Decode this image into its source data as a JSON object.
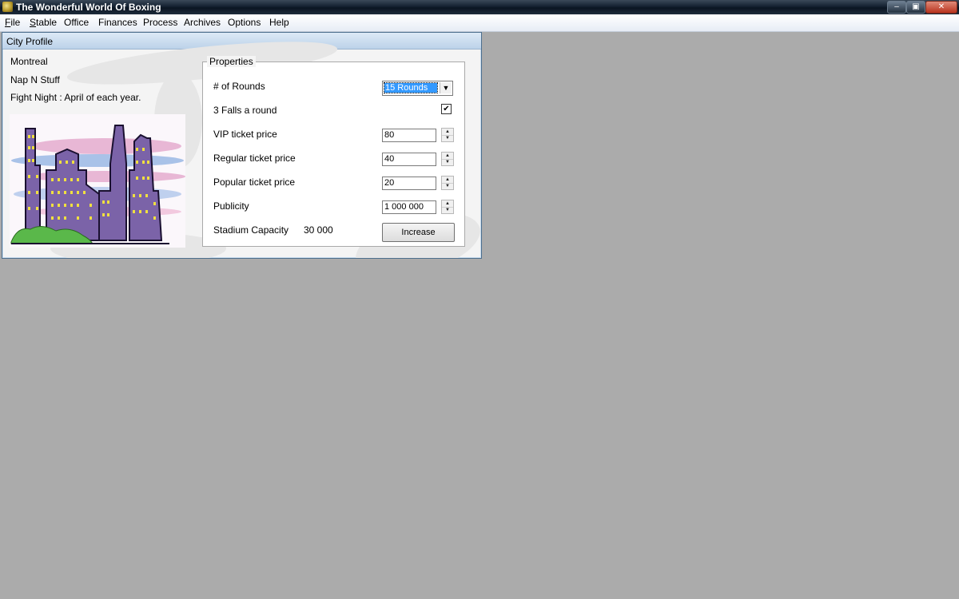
{
  "window": {
    "title": "The Wonderful World Of Boxing",
    "min_glyph": "–",
    "max_glyph": "▣",
    "close_glyph": "✕"
  },
  "menu": [
    "File",
    "Stable",
    "Office",
    "Finances",
    "Process",
    "Archives",
    "Options",
    "Help"
  ],
  "city_profile": {
    "title": "City Profile",
    "city": "Montreal",
    "promotion": "Nap N Stuff",
    "fight_night": "Fight Night : April of each year.",
    "image_icon": "city-skyline-icon"
  },
  "properties": {
    "legend": "Properties",
    "rounds": {
      "label": "# of Rounds",
      "value": "15 Rounds"
    },
    "falls": {
      "label": "3 Falls a round",
      "checked": true,
      "check_glyph": "✔"
    },
    "vip": {
      "label": "VIP ticket price",
      "value": "80"
    },
    "regular": {
      "label": "Regular ticket price",
      "value": "40"
    },
    "popular": {
      "label": "Popular ticket price",
      "value": "20"
    },
    "publicity": {
      "label": "Publicity",
      "value": "1 000 000"
    },
    "capacity": {
      "label": "Stadium Capacity",
      "value": "30 000"
    },
    "increase_label": "Increase"
  },
  "colors": {
    "titlebar": "#142131",
    "desktop": "#ababab",
    "building": "#7b63a8",
    "window_light": "#f0e040",
    "grass": "#5ab84a",
    "selection": "#3399ff"
  }
}
